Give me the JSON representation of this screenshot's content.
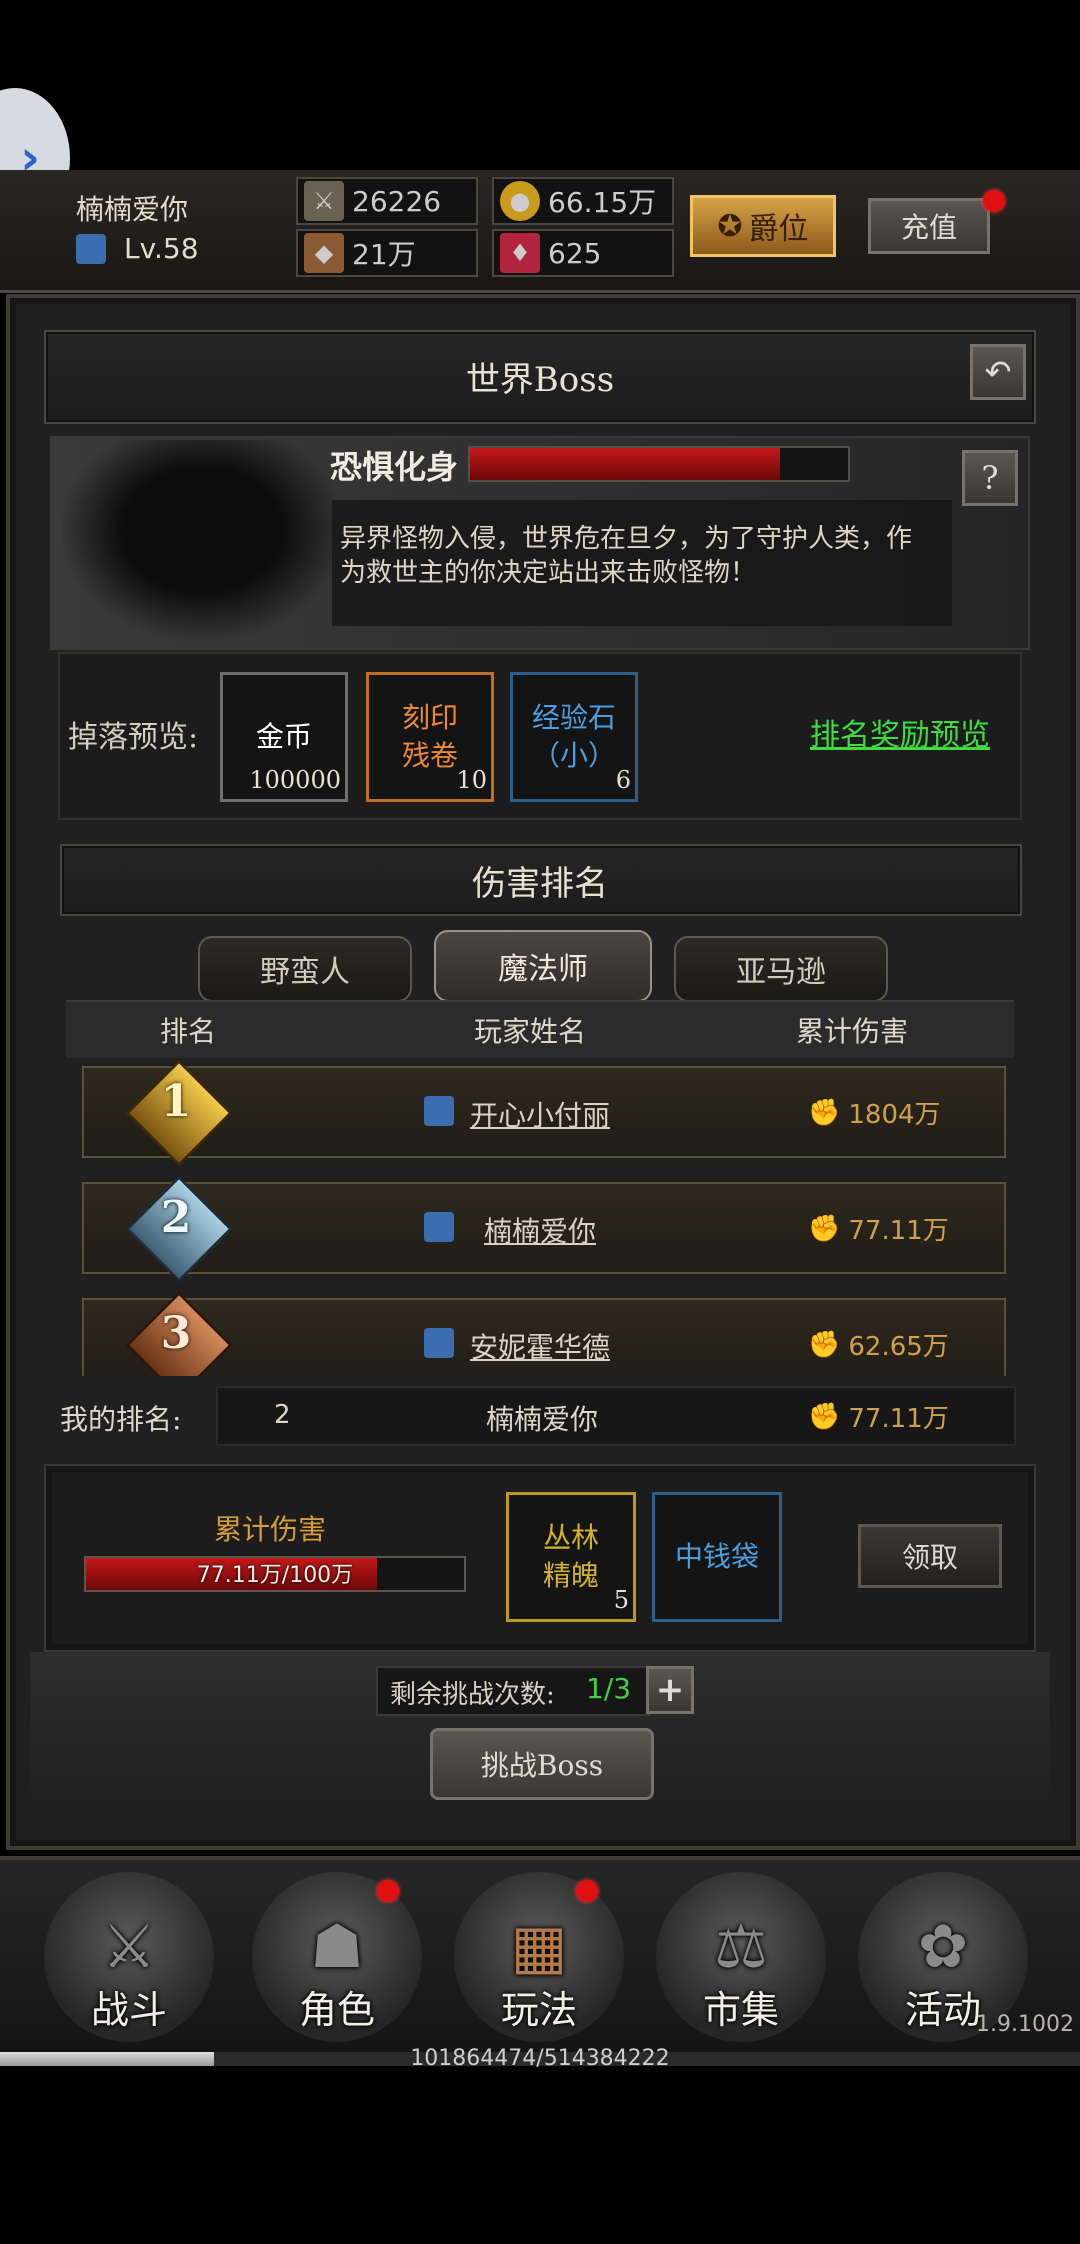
{
  "header": {
    "player_name": "楠楠爱你",
    "level": "Lv.58",
    "stats": {
      "attack": "26226",
      "gold": "66.15万",
      "defense": "21万",
      "gems": "625"
    },
    "rank_button": "爵位",
    "recharge_button": "充值"
  },
  "title": "世界Boss",
  "boss": {
    "name": "恐惧化身",
    "hp_fraction": 0.82,
    "help": "?",
    "description": "异界怪物入侵，世界危在旦夕，为了守护人类，作为救世主的你决定站出来击败怪物！"
  },
  "drops": {
    "label": "掉落预览:",
    "items": [
      {
        "name": "金币",
        "count": "100000"
      },
      {
        "name": "刻印\n残卷",
        "count": "10"
      },
      {
        "name": "经验石\n（小）",
        "count": "6"
      }
    ],
    "reward_preview": "排名奖励预览"
  },
  "ranking": {
    "title": "伤害排名",
    "tabs": [
      "野蛮人",
      "魔法师",
      "亚马逊"
    ],
    "active_tab": "魔法师",
    "headers": [
      "排名",
      "玩家姓名",
      "累计伤害"
    ],
    "rows": [
      {
        "rank": "1",
        "name": "开心小付丽",
        "damage": "1804万"
      },
      {
        "rank": "2",
        "name": "楠楠爱你",
        "damage": "77.11万"
      },
      {
        "rank": "3",
        "name": "安妮霍华德",
        "damage": "62.65万"
      }
    ],
    "my_rank_label": "我的排名:",
    "my_rank": "2",
    "my_name": "楠楠爱你",
    "my_damage": "77.11万"
  },
  "cumulative": {
    "label": "累计伤害",
    "progress_text": "77.11万/100万",
    "progress_fraction": 0.7711,
    "rewards": [
      {
        "name": "丛林\n精魄",
        "count": "5"
      },
      {
        "name": "中钱袋",
        "count": ""
      }
    ],
    "claim_button": "领取"
  },
  "challenge": {
    "remaining_label": "剩余挑战次数:",
    "remaining_value": "1/3",
    "plus": "+",
    "button": "挑战Boss"
  },
  "bottom_nav": [
    "战斗",
    "角色",
    "玩法",
    "市集",
    "活动"
  ],
  "footer": {
    "version": "1.9.1002",
    "download_progress": "101864474/514384222",
    "download_fraction": 0.198
  }
}
